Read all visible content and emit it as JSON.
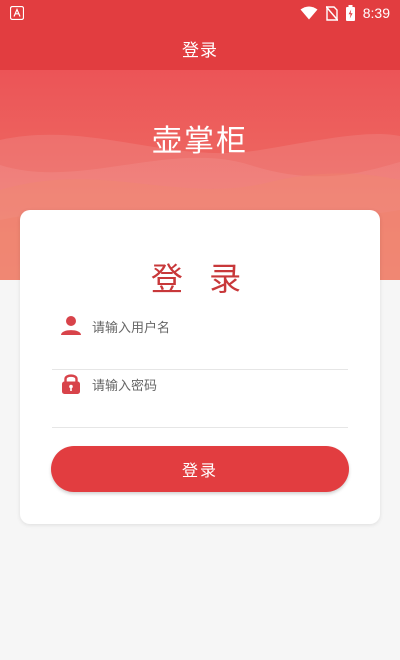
{
  "status_bar": {
    "time": "8:39",
    "icons": [
      "app-notification-icon",
      "wifi-icon",
      "no-sim-icon",
      "battery-icon"
    ]
  },
  "app_bar": {
    "title": "登录"
  },
  "hero": {
    "brand": "壶掌柜"
  },
  "login_card": {
    "heading": "登 录",
    "username": {
      "icon": "user-icon",
      "placeholder": "请输入用户名"
    },
    "password": {
      "icon": "lock-icon",
      "placeholder": "请输入密码"
    },
    "submit_label": "登录"
  },
  "colors": {
    "primary": "#e23d40",
    "heading": "#c8383a",
    "hero_top": "#ec5457",
    "hero_bottom": "#ef7a6a",
    "background": "#f6f6f6"
  }
}
